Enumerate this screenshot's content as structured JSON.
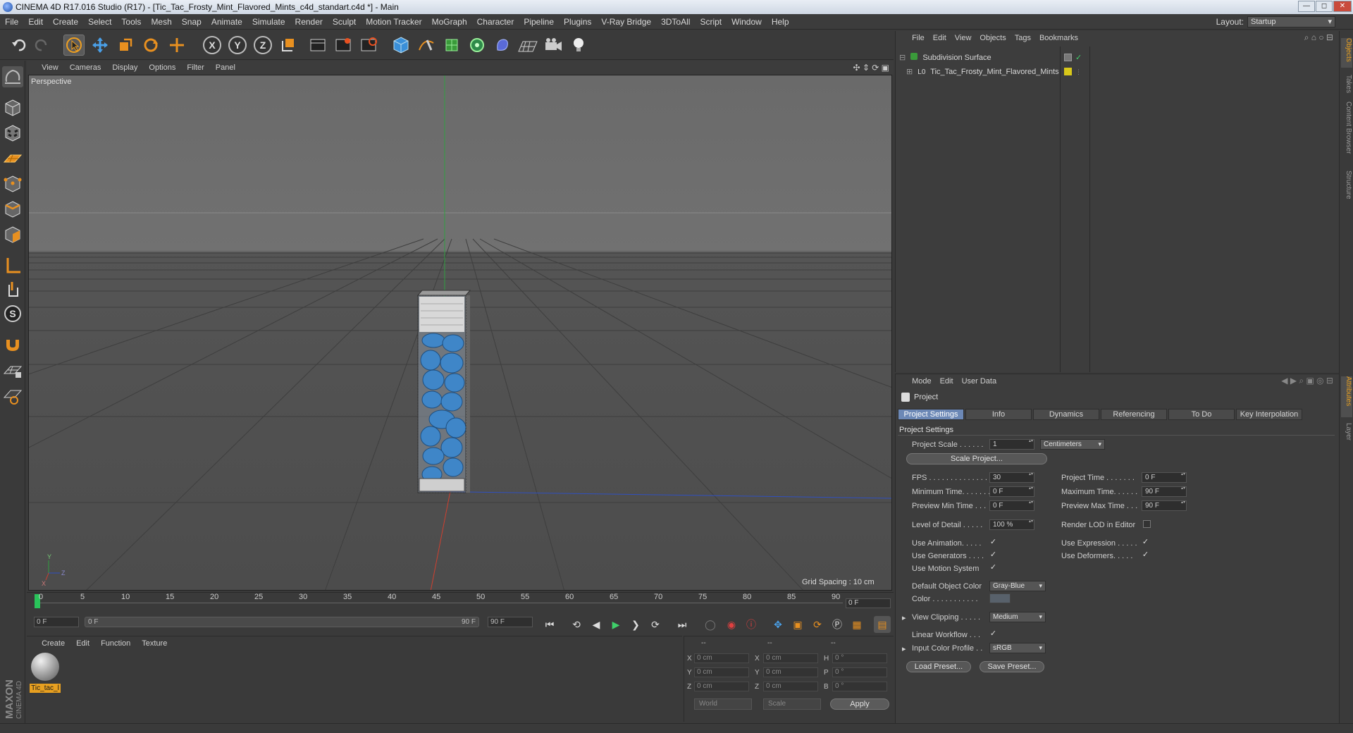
{
  "window": {
    "title": "CINEMA 4D R17.016 Studio (R17) - [Tic_Tac_Frosty_Mint_Flavored_Mints_c4d_standart.c4d *] - Main",
    "controls": [
      "minimize-icon",
      "maximize-icon",
      "close-icon"
    ]
  },
  "menubar": {
    "items": [
      "File",
      "Edit",
      "Create",
      "Select",
      "Tools",
      "Mesh",
      "Snap",
      "Animate",
      "Simulate",
      "Render",
      "Sculpt",
      "Motion Tracker",
      "MoGraph",
      "Character",
      "Pipeline",
      "Plugins",
      "V-Ray Bridge",
      "3DToAll",
      "Script",
      "Window",
      "Help"
    ],
    "layout_label": "Layout:",
    "layout_value": "Startup"
  },
  "toolbar": {
    "icons": [
      "undo-icon",
      "redo-icon",
      "live-selection-icon",
      "move-icon",
      "scale-icon",
      "rotate-icon",
      "last-tool-icon",
      "x-axis-lock-icon",
      "y-axis-lock-icon",
      "z-axis-lock-icon",
      "coordinate-system-icon",
      "render-view-icon",
      "render-picture-viewer-icon",
      "render-settings-icon",
      "cube-icon",
      "pen-spline-icon",
      "subdivision-surface-icon",
      "cloner-icon",
      "deformer-icon",
      "floor-icon",
      "camera-icon",
      "light-icon"
    ],
    "axis_labels": [
      "X",
      "Y",
      "Z"
    ]
  },
  "left_tools": [
    "make-editable-icon",
    "model-mode-icon",
    "texture-mode-icon",
    "workplane-icon",
    "points-mode-icon",
    "edges-mode-icon",
    "polygons-mode-icon",
    "enable-axis-icon",
    "tweak-mode-icon",
    "snap-icon",
    "magnet-icon",
    "lock-workplane-icon",
    "grid-snap-icon"
  ],
  "viewport": {
    "menu": [
      "View",
      "Cameras",
      "Display",
      "Options",
      "Filter",
      "Panel"
    ],
    "label": "Perspective",
    "grid_spacing": "Grid Spacing : 10 cm",
    "axis_labels": [
      "Y",
      "Z",
      "X"
    ]
  },
  "timeline": {
    "ticks": [
      "0",
      "5",
      "10",
      "15",
      "20",
      "25",
      "30",
      "35",
      "40",
      "45",
      "50",
      "55",
      "60",
      "65",
      "70",
      "75",
      "80",
      "85",
      "90"
    ],
    "current_frame": "0 F",
    "start_field": "0 F",
    "range_start": "0 F",
    "range_end": "90 F",
    "end_field": "90 F"
  },
  "transport": [
    "go-to-start-icon",
    "previous-key-icon",
    "play-backwards-icon",
    "play-icon",
    "play-forwards-icon",
    "next-key-icon",
    "go-to-end-icon",
    "autokey-icon",
    "record-icon",
    "help-keyframe-icon",
    "move-key-icon",
    "scale-key-icon",
    "rotate-key-icon",
    "parameter-key-icon",
    "pla-key-icon",
    "timeline-icon"
  ],
  "material_manager": {
    "menu": [
      "Create",
      "Edit",
      "Function",
      "Texture"
    ],
    "material_name": "Tic_tac_l"
  },
  "coordinates": {
    "headers": [
      "--",
      "--",
      "--"
    ],
    "rows": [
      {
        "a": "X",
        "av": "0 cm",
        "b": "X",
        "bv": "0 cm",
        "c": "H",
        "cv": "0 °"
      },
      {
        "a": "Y",
        "av": "0 cm",
        "b": "Y",
        "bv": "0 cm",
        "c": "P",
        "cv": "0 °"
      },
      {
        "a": "Z",
        "av": "0 cm",
        "b": "Z",
        "bv": "0 cm",
        "c": "B",
        "cv": "0 °"
      }
    ],
    "mode1": "World",
    "mode2": "Scale",
    "apply": "Apply"
  },
  "object_manager": {
    "menu": [
      "File",
      "Edit",
      "View",
      "Objects",
      "Tags",
      "Bookmarks"
    ],
    "objects": [
      {
        "name": "Subdivision Surface"
      },
      {
        "name": "Tic_Tac_Frosty_Mint_Flavored_Mints"
      }
    ]
  },
  "attribute_manager": {
    "menu": [
      "Mode",
      "Edit",
      "User Data"
    ],
    "header": "Project",
    "tabs": [
      "Project Settings",
      "Info",
      "Dynamics",
      "Referencing",
      "To Do",
      "Key Interpolation"
    ],
    "section": "Project Settings",
    "project_scale_label": "Project Scale . . . . . .",
    "project_scale": "1",
    "units": "Centimeters",
    "scale_project_btn": "Scale Project...",
    "fps_label": "FPS . . . . . . . . . . . . . .",
    "fps": "30",
    "project_time_label": "Project Time . . . . . . .",
    "project_time": "0 F",
    "min_time_label": "Minimum Time. . . . . . .",
    "min_time": "0 F",
    "max_time_label": "Maximum Time. . . . . .",
    "max_time": "90 F",
    "preview_min_label": "Preview Min Time . . .",
    "preview_min": "0 F",
    "preview_max_label": "Preview Max Time . . .",
    "preview_max": "90 F",
    "lod_label": "Level of Detail . . . . .",
    "lod": "100 %",
    "render_lod_label": "Render LOD in Editor",
    "use_animation": "Use Animation. . . . .",
    "use_expression": "Use Expression . . . . .",
    "use_generators": "Use Generators . . . .",
    "use_deformers": "Use Deformers. . . . .",
    "use_motion": "Use Motion System",
    "default_color_label": "Default Object Color",
    "default_color": "Gray-Blue",
    "color_label": "Color . . . . . . . . . . .",
    "view_clipping_label": "View Clipping . . . . .",
    "view_clipping": "Medium",
    "linear_workflow_label": "Linear Workflow . . .",
    "input_profile_label": "Input Color Profile . .",
    "input_profile": "sRGB",
    "load_preset": "Load Preset...",
    "save_preset": "Save Preset..."
  },
  "right_tabs": [
    "Objects",
    "Takes",
    "Content Browser",
    "Structure",
    "Attributes",
    "Layer"
  ],
  "colors": {
    "accent": "#e8a020",
    "active_tab": "#6c88b6",
    "axis_x": "#d04030",
    "axis_y": "#30a040",
    "axis_z": "#3050c0",
    "capsule": "#3f86c8"
  }
}
